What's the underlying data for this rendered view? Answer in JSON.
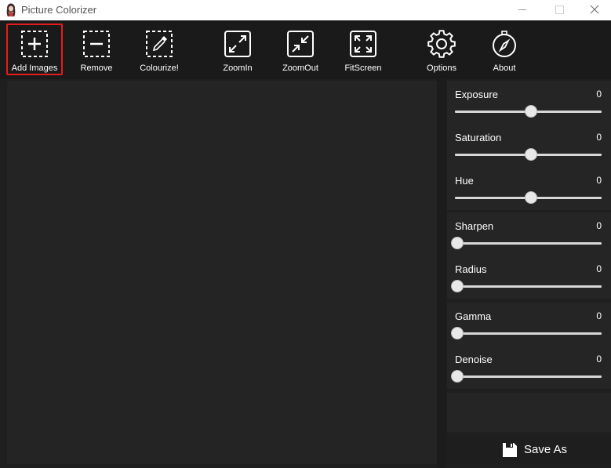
{
  "window": {
    "title": "Picture Colorizer"
  },
  "toolbar": {
    "items": [
      {
        "label": "Add Images",
        "icon": "add-image-icon"
      },
      {
        "label": "Remove",
        "icon": "remove-icon"
      },
      {
        "label": "Colourize!",
        "icon": "eyedropper-icon"
      },
      {
        "label": "ZoomIn",
        "icon": "zoom-in-icon"
      },
      {
        "label": "ZoomOut",
        "icon": "zoom-out-icon"
      },
      {
        "label": "FitScreen",
        "icon": "fit-screen-icon"
      },
      {
        "label": "Options",
        "icon": "gear-icon"
      },
      {
        "label": "About",
        "icon": "compass-icon"
      }
    ]
  },
  "adjustments": {
    "exposure": {
      "label": "Exposure",
      "value": "0",
      "level": 0.5
    },
    "saturation": {
      "label": "Saturation",
      "value": "0",
      "level": 0.5
    },
    "hue": {
      "label": "Hue",
      "value": "0",
      "level": 0.5
    },
    "sharpen": {
      "label": "Sharpen",
      "value": "0",
      "level": 0
    },
    "radius": {
      "label": "Radius",
      "value": "0",
      "level": 0
    },
    "gamma": {
      "label": "Gamma",
      "value": "0",
      "level": 0
    },
    "denoise": {
      "label": "Denoise",
      "value": "0",
      "level": 0
    }
  },
  "save": {
    "label": "Save As",
    "icon": "floppy-disk-icon"
  },
  "colors": {
    "highlight": "#e51c1c",
    "background": "#1f1f1f",
    "panel": "#252525"
  }
}
